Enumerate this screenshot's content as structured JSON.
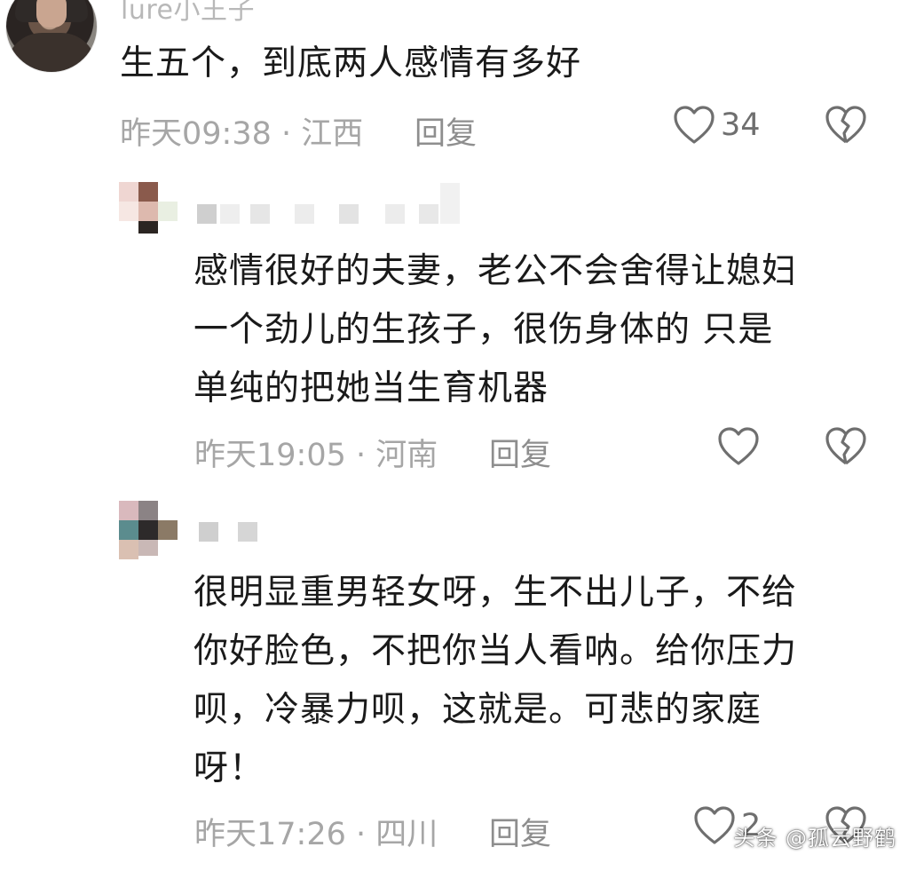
{
  "comments": [
    {
      "username": "lure小王子",
      "text": "生五个，到底两人感情有多好",
      "time": "昨天09:38",
      "sep": "·",
      "location": "江西",
      "reply_label": "回复",
      "likes": "34"
    },
    {
      "username": "",
      "text": "感情很好的夫妻，老公不会舍得让媳妇\n一个劲儿的生孩子，很伤身体的 只是\n单纯的把她当生育机器",
      "time": "昨天19:05",
      "sep": "·",
      "location": "河南",
      "reply_label": "回复",
      "likes": ""
    },
    {
      "username": "",
      "text": "很明显重男轻女呀，生不出儿子，不给\n你好脸色，不把你当人看呐。给你压力\n呗，冷暴力呗，这就是。可悲的家庭\n呀！",
      "time": "昨天17:26",
      "sep": "·",
      "location": "四川",
      "reply_label": "回复",
      "likes": "2"
    }
  ],
  "watermark": "头条 @孤云野鹤",
  "colors": {
    "text": "#1a1a1a",
    "meta": "#a6a6a6",
    "icon": "#6f6f6f"
  },
  "icons": {
    "like": "heart-outline-icon",
    "dislike": "broken-heart-icon"
  }
}
